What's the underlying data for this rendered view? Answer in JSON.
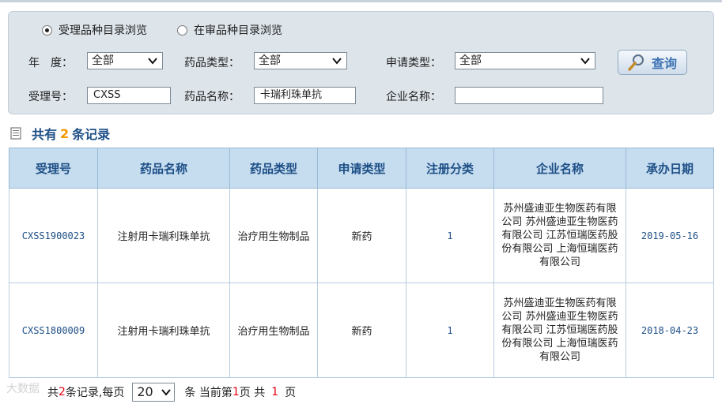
{
  "search": {
    "radio_options": [
      {
        "label": "受理品种目录浏览",
        "checked": true
      },
      {
        "label": "在审品种目录浏览",
        "checked": false
      }
    ],
    "year_label": "年　度：",
    "year_value": "全部",
    "drug_type_label": "药品类型：",
    "drug_type_value": "全部",
    "apply_type_label": "申请类型：",
    "apply_type_value": "全部",
    "accept_no_label": "受理号：",
    "accept_no_value": "CXSS",
    "drug_name_label": "药品名称：",
    "drug_name_value": "卡瑞利珠单抗",
    "company_label": "企业名称：",
    "company_value": "",
    "query_button": "查询",
    "query_icon": "magnifier-icon"
  },
  "summary": {
    "prefix": "共有",
    "count": "2",
    "suffix": "条记录"
  },
  "table": {
    "columns": [
      "受理号",
      "药品名称",
      "药品类型",
      "申请类型",
      "注册分类",
      "企业名称",
      "承办日期"
    ],
    "rows": [
      {
        "accept_no": "CXSS1900023",
        "drug_name": "注射用卡瑞利珠单抗",
        "drug_type": "治疗用生物制品",
        "apply_type": "新药",
        "reg_class": "1",
        "company": "苏州盛迪亚生物医药有限公司 苏州盛迪亚生物医药有限公司 江苏恒瑞医药股份有限公司 上海恒瑞医药有限公司",
        "date": "2019-05-16"
      },
      {
        "accept_no": "CXSS1800009",
        "drug_name": "注射用卡瑞利珠单抗",
        "drug_type": "治疗用生物制品",
        "apply_type": "新药",
        "reg_class": "1",
        "company": "苏州盛迪亚生物医药有限公司 苏州盛迪亚生物医药有限公司 江苏恒瑞医药股份有限公司 上海恒瑞医药有限公司",
        "date": "2018-04-23"
      }
    ]
  },
  "pager": {
    "total_prefix": "共",
    "total_count": "2",
    "per_page_label": "条记录,每页",
    "per_page_value": "20",
    "current_label": "条 当前第",
    "current_page": "1",
    "page_suffix": "页 共",
    "total_pages": "1",
    "pages_suffix": "页"
  },
  "watermark": "大数据"
}
